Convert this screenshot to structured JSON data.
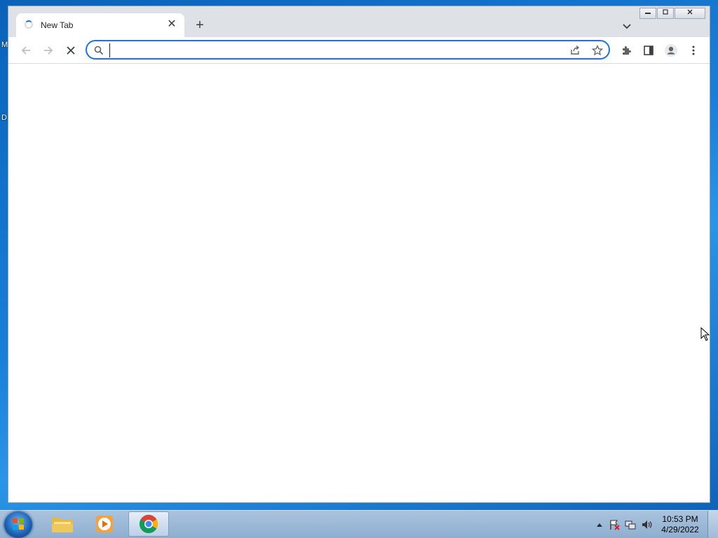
{
  "browser": {
    "tab": {
      "title": "New Tab",
      "close": "✕"
    },
    "new_tab": "+",
    "omnibox": {
      "value": "",
      "placeholder": ""
    }
  },
  "taskbar": {
    "items": [
      {
        "name": "windows-explorer",
        "active": false
      },
      {
        "name": "media-player",
        "active": false
      },
      {
        "name": "google-chrome",
        "active": true
      }
    ],
    "clock": {
      "time": "10:53 PM",
      "date": "4/29/2022"
    }
  },
  "colors": {
    "accent": "#1a73e8",
    "taskbar": "#a9c3de",
    "desktop": "#1a7fd8"
  }
}
